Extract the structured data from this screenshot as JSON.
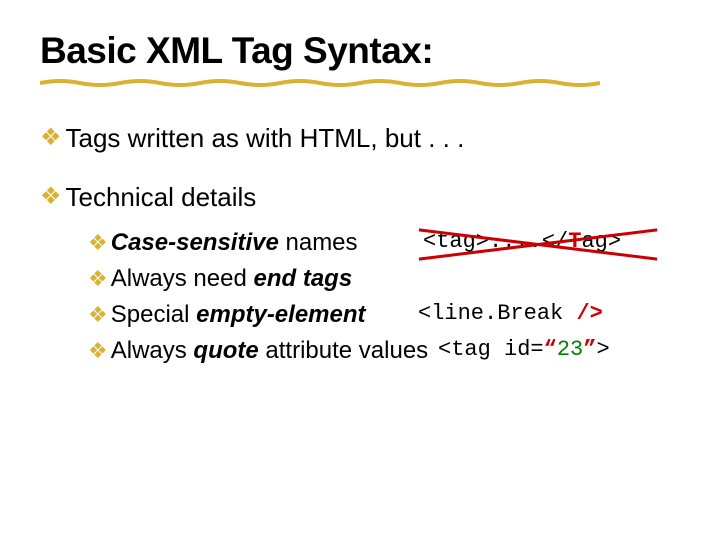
{
  "title": "Basic XML Tag Syntax:",
  "bullets": {
    "b1": "Tags written as with HTML, but . . .",
    "b2": "Technical details"
  },
  "sub": {
    "s1_pre": "Case-sensitive",
    "s1_post": " names",
    "s2_pre": "Always need ",
    "s2_em": "end tags",
    "s3_pre": "Special ",
    "s3_em": "empty-element",
    "s4_pre": "Always ",
    "s4_em": "quote",
    "s4_post": " attribute values"
  },
  "code": {
    "ex1_a": "<tag>",
    "ex1_b": "....",
    "ex1_c": "</",
    "ex1_d": "T",
    "ex1_e": "ag>",
    "ex2_a": "<line.Break ",
    "ex2_b": "/>",
    "ex3_a": "<tag id=",
    "ex3_b": "“",
    "ex3_c": "23",
    "ex3_d": "”",
    "ex3_e": ">"
  }
}
